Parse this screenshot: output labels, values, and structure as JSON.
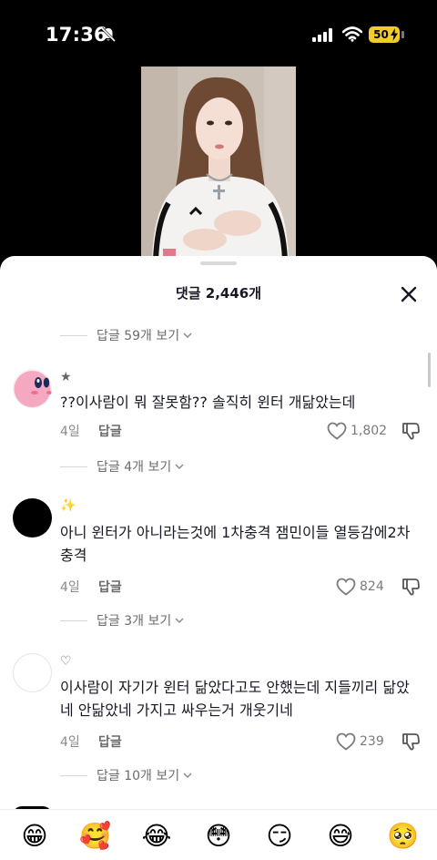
{
  "status": {
    "time": "17:36",
    "battery": "50"
  },
  "sheet": {
    "title": "댓글 2,446개"
  },
  "top_replies": "답글 59개 보기",
  "comments": [
    {
      "username": "★",
      "text": "??이사람이 뭐 잘못함?? 솔직히 윈터 개닮았는데",
      "date": "4일",
      "reply": "답글",
      "likes": "1,802",
      "replies": "답글 4개 보기"
    },
    {
      "username": "✨",
      "text": "아니 윈터가 아니라는것에 1차충격 잼민이들 열등감에2차 충격",
      "date": "4일",
      "reply": "답글",
      "likes": "824",
      "replies": "답글 3개 보기"
    },
    {
      "username": "♡",
      "text": "이사람이 자기가 윈터 닮았다고도 안했는데 지들끼리 닮았네 안닮았네 가지고 싸우는거 개웃기네",
      "date": "4일",
      "reply": "답글",
      "likes": "239",
      "replies": "답글 10개 보기"
    }
  ],
  "emojis": [
    "😁",
    "🥰",
    "😂",
    "😳",
    "😏",
    "😅",
    "🥺"
  ],
  "colors": {
    "sheet_bg": "#ffffff",
    "text_primary": "#161823",
    "text_secondary": "#8a8a8a",
    "battery": "#f2cc2a"
  }
}
